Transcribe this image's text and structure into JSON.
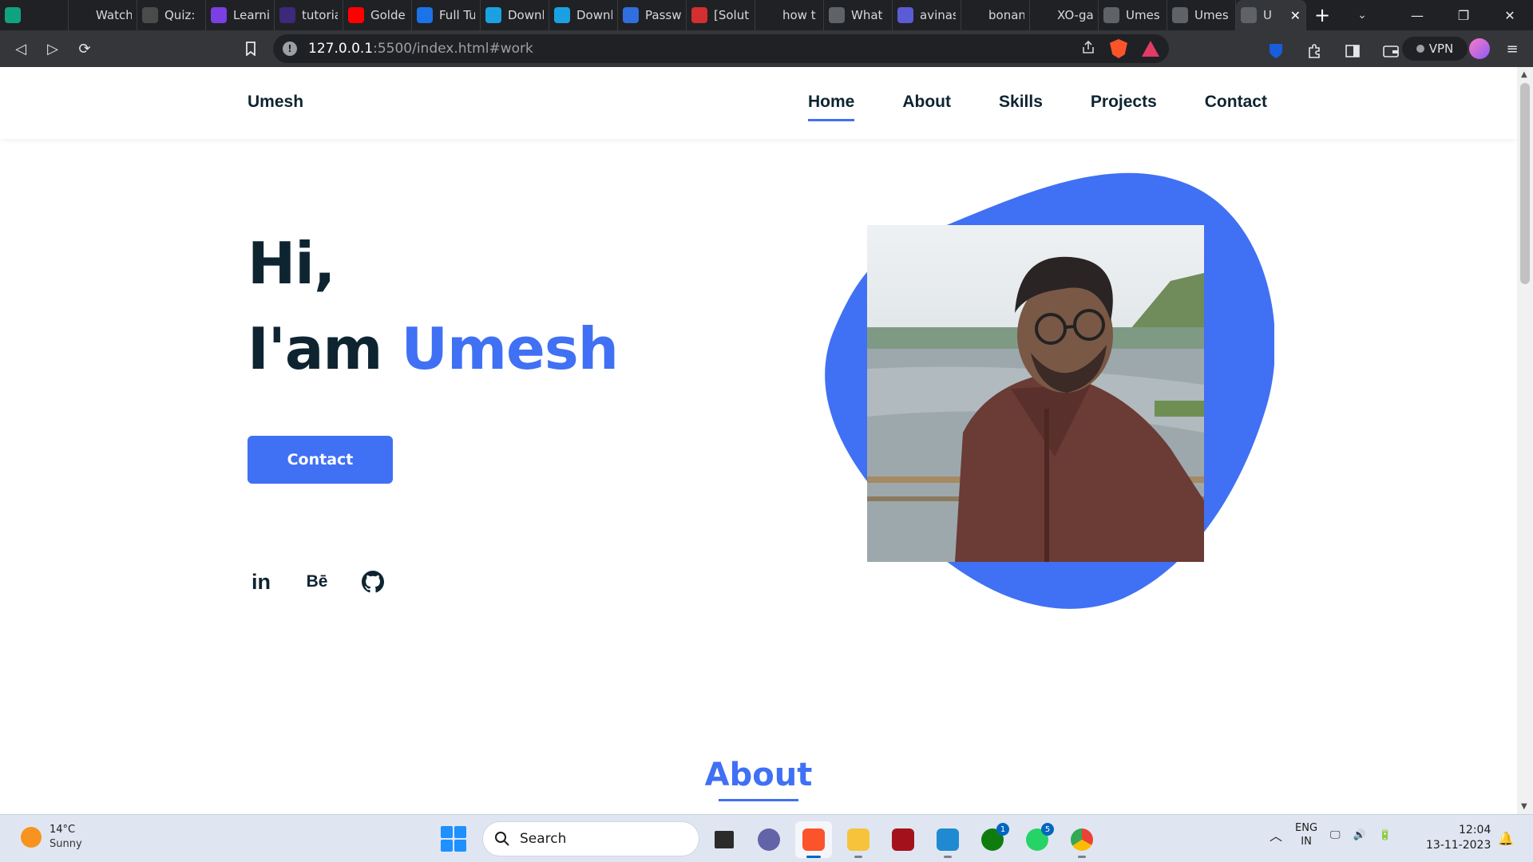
{
  "browser": {
    "tabs": [
      {
        "title": "",
        "icon": "openai-icon",
        "color": "#10a37f"
      },
      {
        "title": "Watch",
        "icon": "watch-icon",
        "color": "#202124"
      },
      {
        "title": "Quiz: |",
        "icon": "g-icon",
        "color": "#4b4b4b"
      },
      {
        "title": "Learni",
        "icon": "learning-icon",
        "color": "#7b3fe4"
      },
      {
        "title": "tutoria",
        "icon": "tf-icon",
        "color": "#3b2a7a"
      },
      {
        "title": "Golde",
        "icon": "youtube-icon",
        "color": "#ff0000"
      },
      {
        "title": "Full Tu",
        "icon": "plus-icon",
        "color": "#1a73e8"
      },
      {
        "title": "Downl",
        "icon": "downloader-icon",
        "color": "#1ba1e2"
      },
      {
        "title": "Downl",
        "icon": "downloader-icon",
        "color": "#1ba1e2"
      },
      {
        "title": "Passw",
        "icon": "key-icon",
        "color": "#2f6fde"
      },
      {
        "title": "[Solut",
        "icon": "t-icon",
        "color": "#d32f2f"
      },
      {
        "title": "how t",
        "icon": "search-icon",
        "color": "#202124"
      },
      {
        "title": "What",
        "icon": "globe-icon",
        "color": "#5f6368"
      },
      {
        "title": "avinas",
        "icon": "app-icon",
        "color": "#5b5bd6"
      },
      {
        "title": "bonan",
        "icon": "github-icon",
        "color": "#202124"
      },
      {
        "title": "XO-ga",
        "icon": "github-icon",
        "color": "#202124"
      },
      {
        "title": "Umes",
        "icon": "globe-icon",
        "color": "#5f6368"
      },
      {
        "title": "Umes",
        "icon": "globe-icon",
        "color": "#5f6368"
      },
      {
        "title": "U",
        "icon": "globe-icon",
        "color": "#5f6368",
        "active": true
      }
    ],
    "url_host": "127.0.0.1",
    "url_rest": ":5500/index.html#work",
    "vpn_label": "VPN"
  },
  "site": {
    "logo": "Umesh",
    "nav": [
      "Home",
      "About",
      "Skills",
      "Projects",
      "Contact"
    ],
    "active_nav": "Home",
    "hero": {
      "greeting": "Hi,",
      "intro": "I'am",
      "name": "Umesh",
      "contact_button": "Contact"
    },
    "social": {
      "linkedin": "in",
      "behance": "Bē"
    },
    "section_title": "About",
    "accent_color": "#4070f4",
    "text_color": "#0e2431"
  },
  "taskbar": {
    "weather_temp": "14°C",
    "weather_desc": "Sunny",
    "search_label": "Search",
    "badges": {
      "xbox": "1",
      "whatsapp": "5"
    },
    "lang_top": "ENG",
    "lang_bottom": "IN",
    "time": "12:04",
    "date": "13-11-2023"
  }
}
